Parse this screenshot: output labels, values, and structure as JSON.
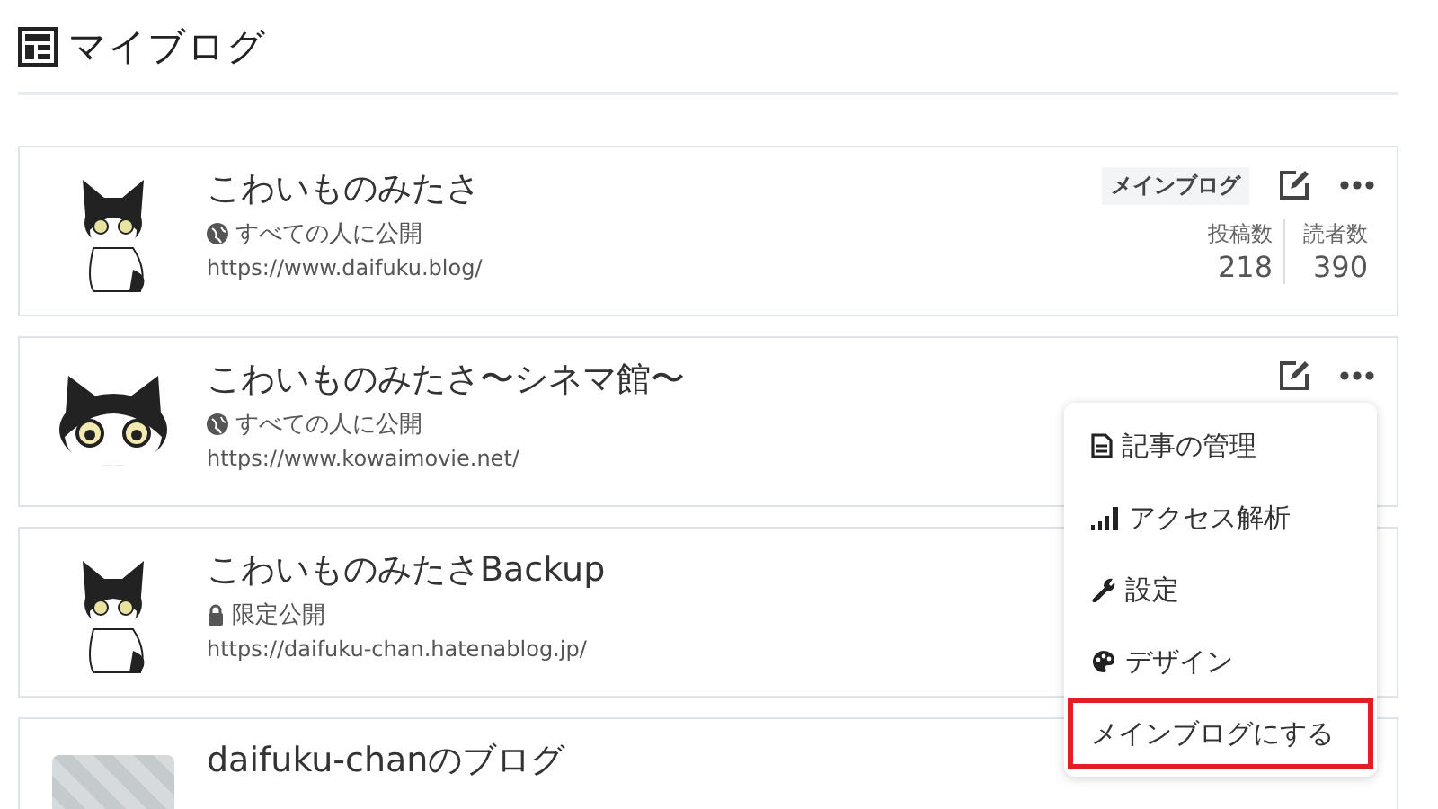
{
  "page": {
    "title": "マイブログ"
  },
  "blogs": [
    {
      "title": "こわいものみたさ",
      "avatar": {
        "kind": "sitting"
      },
      "privacy": {
        "kind": "public",
        "label": "すべての人に公開"
      },
      "url": "https://www.daifuku.blog/",
      "badge": "メインブログ",
      "actions": true,
      "stats": [
        {
          "label": "投稿数",
          "value": "218"
        },
        {
          "label": "読者数",
          "value": "390"
        }
      ]
    },
    {
      "title": "こわいものみたさ〜シネマ館〜",
      "avatar": {
        "kind": "face"
      },
      "privacy": {
        "kind": "public",
        "label": "すべての人に公開"
      },
      "url": "https://www.kowaimovie.net/",
      "actions": true
    },
    {
      "title": "こわいものみたさBackup",
      "avatar": {
        "kind": "sitting"
      },
      "privacy": {
        "kind": "limited",
        "label": "限定公開"
      },
      "url": "https://daifuku-chan.hatenablog.jp/",
      "actions": false
    },
    {
      "title": "daifuku-chanのブログ",
      "avatar": {
        "kind": "pattern"
      },
      "actions": false
    }
  ],
  "menu": {
    "items": [
      {
        "kind": "document",
        "label": "記事の管理",
        "highlighted": false
      },
      {
        "kind": "signal",
        "label": "アクセス解析",
        "highlighted": false
      },
      {
        "kind": "wrench",
        "label": "設定",
        "highlighted": false
      },
      {
        "kind": "palette",
        "label": "デザイン",
        "highlighted": false
      },
      {
        "kind": "plain",
        "label": "メインブログにする",
        "highlighted": true
      }
    ]
  }
}
